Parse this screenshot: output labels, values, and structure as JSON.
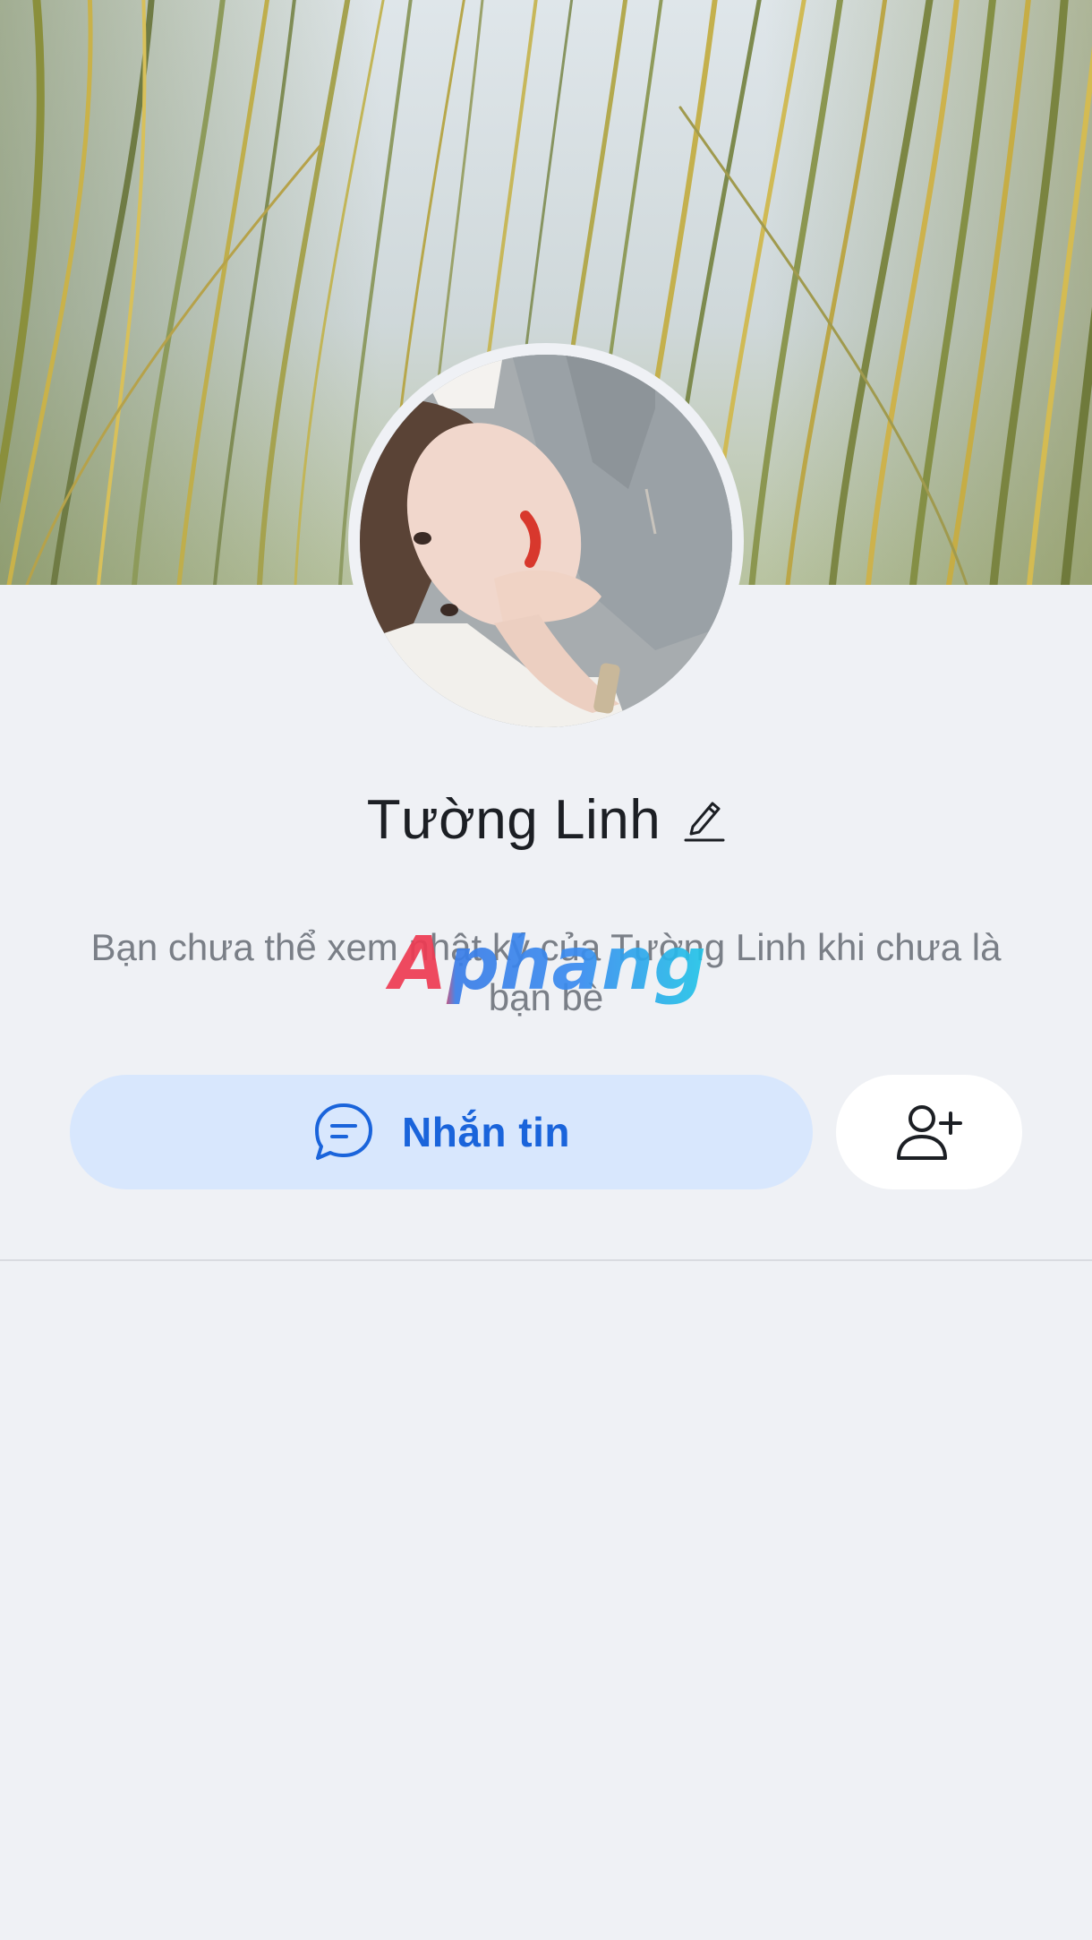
{
  "profile": {
    "name": "Tường Linh",
    "edit_icon": "pencil-edit-icon",
    "cover_photo": "grass-cover-photo",
    "avatar_photo": "profile-avatar-photo"
  },
  "privacy_notice": {
    "text": "Bạn chưa thể xem nhật ký của Tường Linh khi chưa là bạn bè"
  },
  "watermark": {
    "text": "Aphang"
  },
  "actions": {
    "message_label": "Nhắn tin",
    "message_icon": "chat-bubble-icon",
    "add_friend_icon": "add-friend-icon"
  },
  "colors": {
    "background": "#eff1f5",
    "accent": "#1a64db",
    "accent_bg": "#d8e7fd",
    "text_primary": "#1c1f24",
    "text_secondary": "#7a7f87"
  }
}
